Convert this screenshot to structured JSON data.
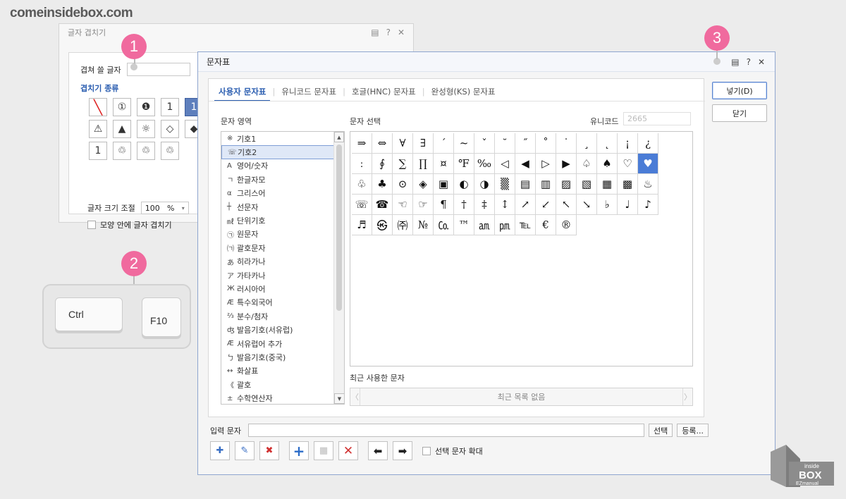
{
  "watermark": "comeinsidebox.com",
  "bg_dialog": {
    "title": "글자 겹치기",
    "field_label": "겹쳐 쓸 글자",
    "section_title": "겹치기 종류",
    "size_label": "글자 크기 조절",
    "size_value": "100",
    "size_unit": "%",
    "checkbox_label": "모양 안에 글자 겹치기",
    "shapes": [
      "╲",
      "①",
      "❶",
      "1",
      "1",
      "⚠",
      "▲",
      "☼",
      "◇",
      "◆",
      "1",
      "♲",
      "♲",
      "♲"
    ]
  },
  "markers": [
    "1",
    "2",
    "3"
  ],
  "keys": {
    "ctrl": "Ctrl",
    "f10": "F10"
  },
  "main": {
    "title": "문자표",
    "tabs": [
      "사용자 문자표",
      "유니코드 문자표",
      "호글(HNC) 문자표",
      "완성형(KS) 문자표"
    ],
    "area_label": "문자 영역",
    "select_label": "문자 선택",
    "unicode_label": "유니코드",
    "unicode_value": "2665",
    "recent_label": "최근 사용한 문자",
    "recent_empty": "최근 목록 없음",
    "input_label": "입력 문자",
    "select_btn": "선택",
    "register_btn": "등록...",
    "insert_btn": "넣기(D)",
    "close_btn": "닫기",
    "enlarge_label": "선택 문자 확대",
    "categories": [
      {
        "icon": "※",
        "label": "기호1"
      },
      {
        "icon": "☏",
        "label": "기호2"
      },
      {
        "icon": "A",
        "label": "영어/숫자"
      },
      {
        "icon": "ㄱ",
        "label": "한글자모"
      },
      {
        "icon": "α",
        "label": "그리스어"
      },
      {
        "icon": "┼",
        "label": "선문자"
      },
      {
        "icon": "㎖",
        "label": "단위기호"
      },
      {
        "icon": "㉠",
        "label": "원문자"
      },
      {
        "icon": "㈀",
        "label": "괄호문자"
      },
      {
        "icon": "あ",
        "label": "히라가나"
      },
      {
        "icon": "ア",
        "label": "가타카나"
      },
      {
        "icon": "Ж",
        "label": "러시아어"
      },
      {
        "icon": "Æ",
        "label": "특수외국어"
      },
      {
        "icon": "⅔",
        "label": "분수/첨자"
      },
      {
        "icon": "ʤ",
        "label": "발음기호(서유럽)"
      },
      {
        "icon": "Æ",
        "label": "서유럽어 추가"
      },
      {
        "icon": "ㄅ",
        "label": "발음기호(중국)"
      },
      {
        "icon": "↔",
        "label": "화살표"
      },
      {
        "icon": "《",
        "label": "괄호"
      },
      {
        "icon": "±",
        "label": "수학연산자"
      }
    ],
    "selected_category": "기호2",
    "chars": [
      "⇒",
      "⇔",
      "∀",
      "∃",
      "´",
      "~",
      "ˇ",
      "˘",
      "˝",
      "˚",
      "˙",
      "¸",
      "˛",
      "¡",
      "¿",
      "ː",
      "∮",
      "∑",
      "∏",
      "¤",
      "℉",
      "‰",
      "◁",
      "◀",
      "▷",
      "▶",
      "♤",
      "♠",
      "♡",
      "♥",
      "♧",
      "♣",
      "⊙",
      "◈",
      "▣",
      "◐",
      "◑",
      "▒",
      "▤",
      "▥",
      "▨",
      "▧",
      "▦",
      "▩",
      "♨",
      "☏",
      "☎",
      "☜",
      "☞",
      "¶",
      "†",
      "‡",
      "↕",
      "↗",
      "↙",
      "↖",
      "↘",
      "♭",
      "♩",
      "♪",
      "♬",
      "㉿",
      "㈜",
      "№",
      "㏇",
      "™",
      "㏂",
      "㏘",
      "℡",
      "€",
      "®"
    ],
    "selected_char": "♥"
  },
  "logo_text": {
    "top": "inside",
    "mid": "BOX",
    "bottom": "EZmanual"
  }
}
